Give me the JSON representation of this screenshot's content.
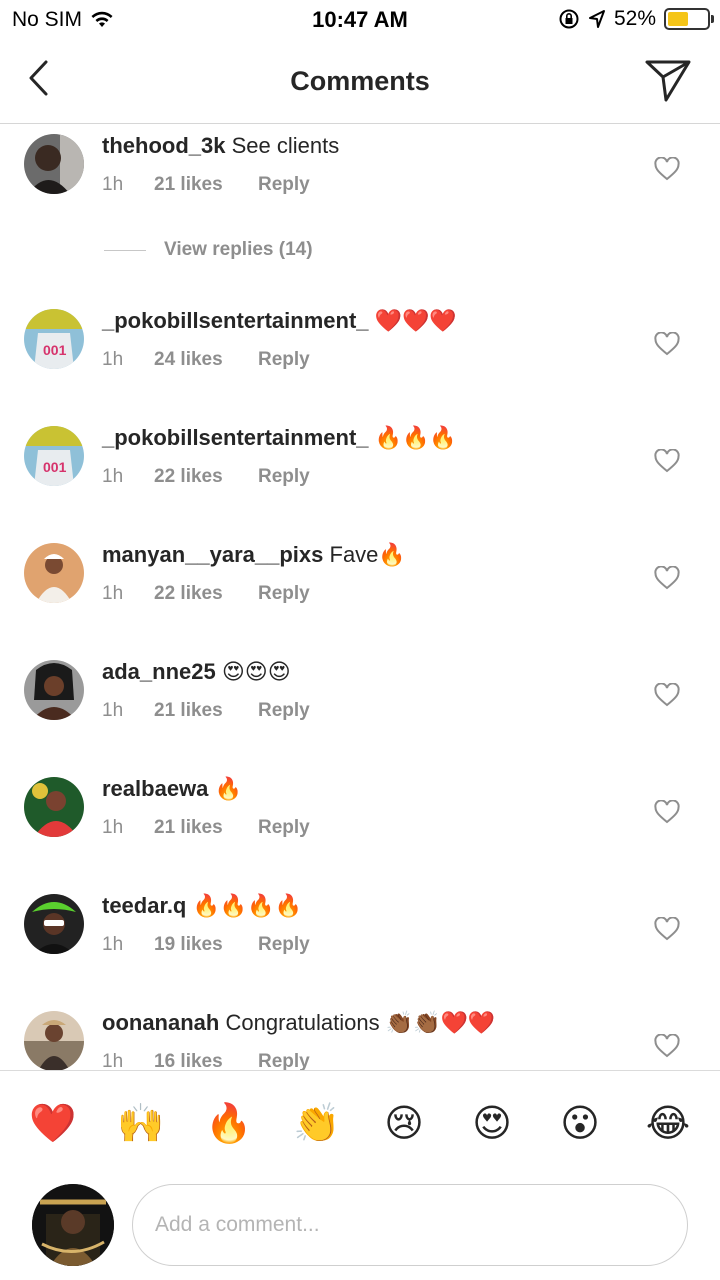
{
  "status_bar": {
    "carrier": "No SIM",
    "time": "10:47 AM",
    "battery": "52%",
    "battery_level": 0.52
  },
  "nav": {
    "title": "Comments"
  },
  "comments": [
    {
      "username": "thehood_3k",
      "text": "See clients",
      "time": "1h",
      "likes": "21 likes",
      "reply": "Reply"
    },
    {
      "username": "_pokobillsentertainment_",
      "text": "❤️❤️❤️",
      "time": "1h",
      "likes": "24 likes",
      "reply": "Reply"
    },
    {
      "username": "_pokobillsentertainment_",
      "text": "🔥🔥🔥",
      "time": "1h",
      "likes": "22 likes",
      "reply": "Reply"
    },
    {
      "username": "manyan__yara__pixs",
      "text": "Fave🔥",
      "time": "1h",
      "likes": "22 likes",
      "reply": "Reply"
    },
    {
      "username": "ada_nne25",
      "text": "😍😍😍",
      "time": "1h",
      "likes": "21 likes",
      "reply": "Reply"
    },
    {
      "username": "realbaewa",
      "text": "🔥",
      "time": "1h",
      "likes": "21 likes",
      "reply": "Reply"
    },
    {
      "username": "teedar.q",
      "text": "🔥🔥🔥🔥",
      "time": "1h",
      "likes": "19 likes",
      "reply": "Reply"
    },
    {
      "username": "oonananah",
      "text": "Congratulations 👏🏾👏🏾❤️❤️",
      "time": "1h",
      "likes": "16 likes",
      "reply": "Reply"
    }
  ],
  "view_replies": "View replies (14)",
  "reactions": [
    "❤️",
    "🙌",
    "🔥",
    "👏",
    "😢",
    "😍",
    "😮",
    "😂"
  ],
  "composer": {
    "placeholder": "Add a comment..."
  },
  "colors": {
    "meta_gray": "#8e8e8e",
    "text": "#262626",
    "battery": "#f5c518"
  }
}
